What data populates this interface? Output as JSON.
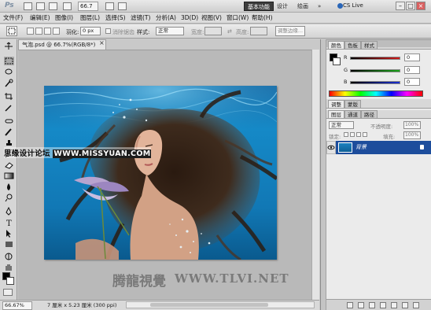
{
  "app": {
    "logo": "Ps",
    "zoom_value": "66.7",
    "workspaces": [
      "基本功能",
      "设计",
      "绘画"
    ],
    "workspace_more": "»",
    "cs_live": "CS Live",
    "window_buttons": [
      "–",
      "□",
      "×"
    ]
  },
  "menu": [
    "文件(F)",
    "编辑(E)",
    "图像(I)",
    "图层(L)",
    "选择(S)",
    "滤镜(T)",
    "分析(A)",
    "3D(D)",
    "视图(V)",
    "窗口(W)",
    "帮助(H)"
  ],
  "options": {
    "feather_label": "羽化:",
    "feather_value": "0 px",
    "antialias_label": "消除锯齿",
    "style_label": "样式:",
    "style_value": "正常",
    "width_label": "宽度:",
    "height_label": "高度:",
    "refine_button": "调整边缘..."
  },
  "document": {
    "tab_title": "气泡.psd @ 66.7%(RGB/8*)",
    "tab_close": "×",
    "status_zoom": "66.67%",
    "status_info": "7 厘米 x 5.23 厘米 (300 ppi)"
  },
  "watermarks": {
    "forum_cn": "思缘设计论坛",
    "forum_url": "WWW.MISSYUAN.COM",
    "tlvi_cn": "腾龍視覺",
    "tlvi_url": "WWW.TLVI.NET"
  },
  "color_panel": {
    "tabs": [
      "颜色",
      "色板",
      "样式"
    ],
    "channels": [
      {
        "label": "R",
        "value": "0",
        "color": "#d21a1a"
      },
      {
        "label": "G",
        "value": "0",
        "color": "#1aa51a"
      },
      {
        "label": "B",
        "value": "0",
        "color": "#1a2fd2"
      }
    ]
  },
  "adjust_tabs": [
    "调整",
    "蒙版"
  ],
  "layers_panel": {
    "tabs": [
      "图层",
      "通道",
      "路径"
    ],
    "blend_mode": "正常",
    "opacity_label": "不透明度:",
    "opacity_value": "100%",
    "lock_label": "锁定:",
    "fill_label": "填充:",
    "fill_value": "100%",
    "layer_name": "背景"
  },
  "colors": {
    "accent": "#1d4d9c",
    "foreground": "#000000",
    "background": "#ffffff"
  }
}
